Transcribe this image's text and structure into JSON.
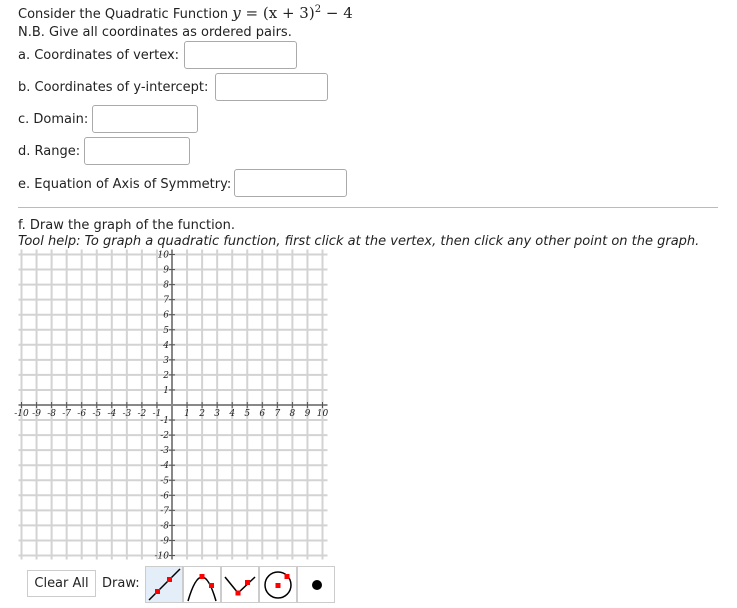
{
  "header": {
    "intro": "Consider the Quadratic Function",
    "function_lhs": "y",
    "function_rhs": "= (x + 3)",
    "exponent": "2",
    "function_tail": "− 4",
    "note": "N.B. Give all coordinates as ordered pairs."
  },
  "questions": [
    {
      "label": "a. Coordinates of vertex:",
      "value": ""
    },
    {
      "label": "b. Coordinates of y-intercept:",
      "value": ""
    },
    {
      "label": "c. Domain:",
      "value": ""
    },
    {
      "label": "d. Range:",
      "value": ""
    },
    {
      "label": "e. Equation of Axis of Symmetry:",
      "value": ""
    }
  ],
  "graph_section": {
    "title": "f. Draw the graph of the function.",
    "help": "Tool help: To graph a quadratic function, first click at the vertex, then click any other point on the graph.",
    "x_range": [
      -10,
      10
    ],
    "y_range": [
      -10,
      10
    ],
    "x_ticks": [
      "-10",
      "-9",
      "-8",
      "-7",
      "-6",
      "-5",
      "-4",
      "-3",
      "-2",
      "-1",
      "1",
      "2",
      "3",
      "4",
      "5",
      "6",
      "7",
      "8",
      "9",
      "10"
    ],
    "y_ticks": [
      "10",
      "9",
      "8",
      "7",
      "6",
      "5",
      "4",
      "3",
      "2",
      "1",
      "-1",
      "-2",
      "-3",
      "-4",
      "-5",
      "-6",
      "-7",
      "-8",
      "-9",
      "-10"
    ]
  },
  "toolbar": {
    "clear_all": "Clear All",
    "draw_label": "Draw:",
    "tools": [
      {
        "icon": "line-tool-icon",
        "selected": true
      },
      {
        "icon": "parabola-tool-icon",
        "selected": false
      },
      {
        "icon": "absolute-value-tool-icon",
        "selected": false
      },
      {
        "icon": "circle-tool-icon",
        "selected": false
      },
      {
        "icon": "point-tool-icon",
        "selected": false
      }
    ],
    "accent": "#ff0000"
  }
}
